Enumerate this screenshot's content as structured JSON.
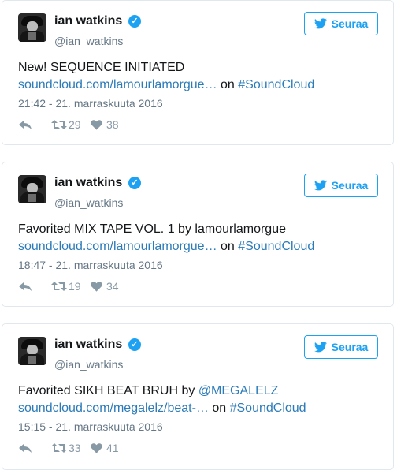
{
  "tweets": [
    {
      "name": "ian watkins",
      "handle": "@ian_watkins",
      "follow_label": "Seuraa",
      "text": "New! SEQUENCE INITIATED",
      "mention": "",
      "link": "soundcloud.com/lamourlamorgue…",
      "on_text": "on",
      "hashtag": "#SoundCloud",
      "timestamp": "21:42 - 21. marraskuuta 2016",
      "retweets": "29",
      "likes": "38"
    },
    {
      "name": "ian watkins",
      "handle": "@ian_watkins",
      "follow_label": "Seuraa",
      "text": "Favorited MIX TAPE VOL. 1 by lamourlamorgue",
      "mention": "",
      "link": "soundcloud.com/lamourlamorgue…",
      "on_text": "on",
      "hashtag": "#SoundCloud",
      "timestamp": "18:47 - 21. marraskuuta 2016",
      "retweets": "19",
      "likes": "34"
    },
    {
      "name": "ian watkins",
      "handle": "@ian_watkins",
      "follow_label": "Seuraa",
      "text": "Favorited SIKH BEAT BRUH by ",
      "mention": "@MEGALELZ",
      "link": "soundcloud.com/megalelz/beat-…",
      "on_text": "on",
      "hashtag": "#SoundCloud",
      "timestamp": "15:15 - 21. marraskuuta 2016",
      "retweets": "33",
      "likes": "41"
    }
  ],
  "colors": {
    "accent": "#1da1f2",
    "link": "#2b7bb9",
    "muted": "#657786",
    "border": "#e1e8ed"
  },
  "icons": [
    "verified-icon",
    "twitter-bird-icon",
    "reply-icon",
    "retweet-icon",
    "heart-icon"
  ]
}
